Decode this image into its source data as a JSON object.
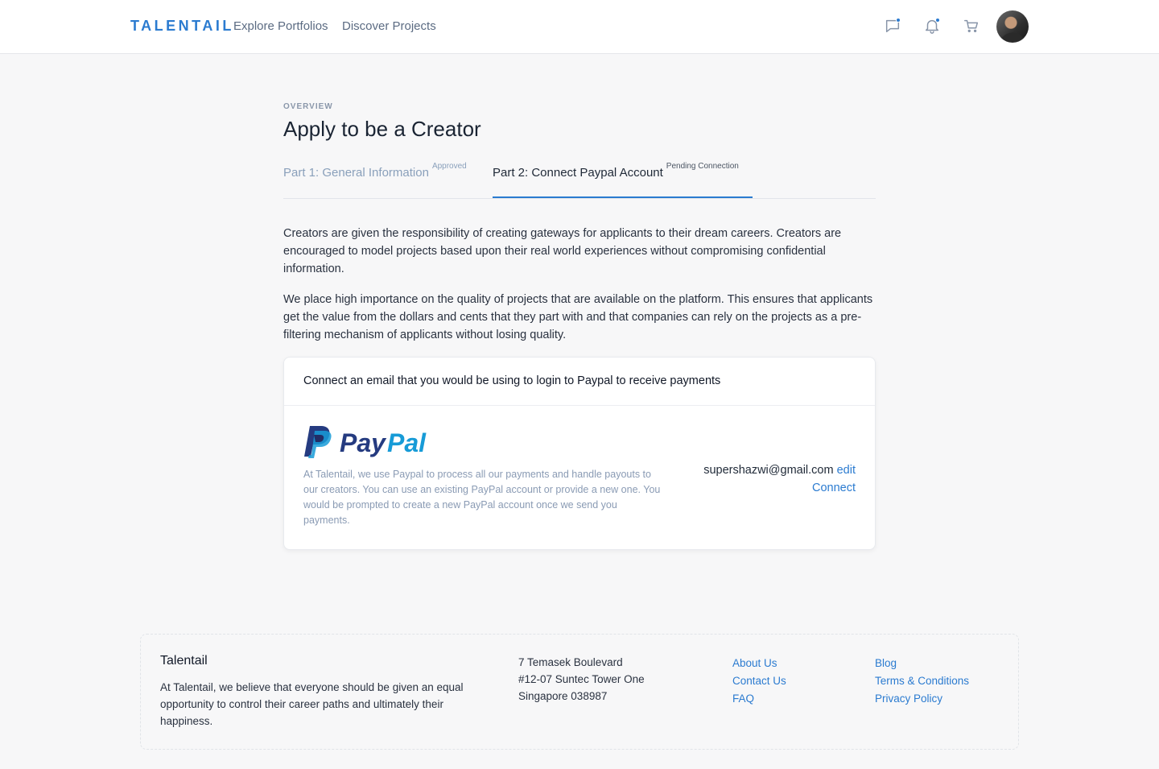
{
  "header": {
    "brand": "TALENTAIL",
    "nav": [
      "Explore Portfolios",
      "Discover Projects"
    ],
    "icons": [
      "chat-icon",
      "bell-icon",
      "cart-icon"
    ],
    "accent": "#2b7bd0"
  },
  "main": {
    "overline": "OVERVIEW",
    "title": "Apply to be a Creator",
    "tabs": [
      {
        "label": "Part 1: General Information",
        "status": "Approved"
      },
      {
        "label": "Part 2: Connect Paypal Account",
        "status": "Pending Connection"
      }
    ],
    "paragraphs": [
      "Creators are given the responsibility of creating gateways for applicants to their dream careers. Creators are encouraged to model projects based upon their real world experiences without compromising confidential information.",
      "We place high importance on the quality of projects that are available on the platform. This ensures that applicants get the value from the dollars and cents that they part with and that companies can rely on the projects as a pre-filtering mechanism of applicants without losing quality."
    ],
    "card": {
      "heading": "Connect an email that you would be using to login to Paypal to receive payments",
      "logo_text": "PayPal",
      "description": "At Talentail, we use Paypal to process all our payments and handle payouts to our creators. You can use an existing PayPal account or provide a new one. You would be prompted to create a new PayPal account once we send you payments.",
      "email": "supershazwi@gmail.com",
      "edit_label": "edit",
      "connect_label": "Connect"
    }
  },
  "footer": {
    "brand": "Talentail",
    "description": "At Talentail, we believe that everyone should be given an equal opportunity to control their career paths and ultimately their happiness.",
    "address": [
      "7 Temasek Boulevard",
      "#12-07 Suntec Tower One",
      "Singapore 038987"
    ],
    "links_1": [
      "About Us",
      "Contact Us",
      "FAQ"
    ],
    "links_2": [
      "Blog",
      "Terms & Conditions",
      "Privacy Policy"
    ]
  }
}
